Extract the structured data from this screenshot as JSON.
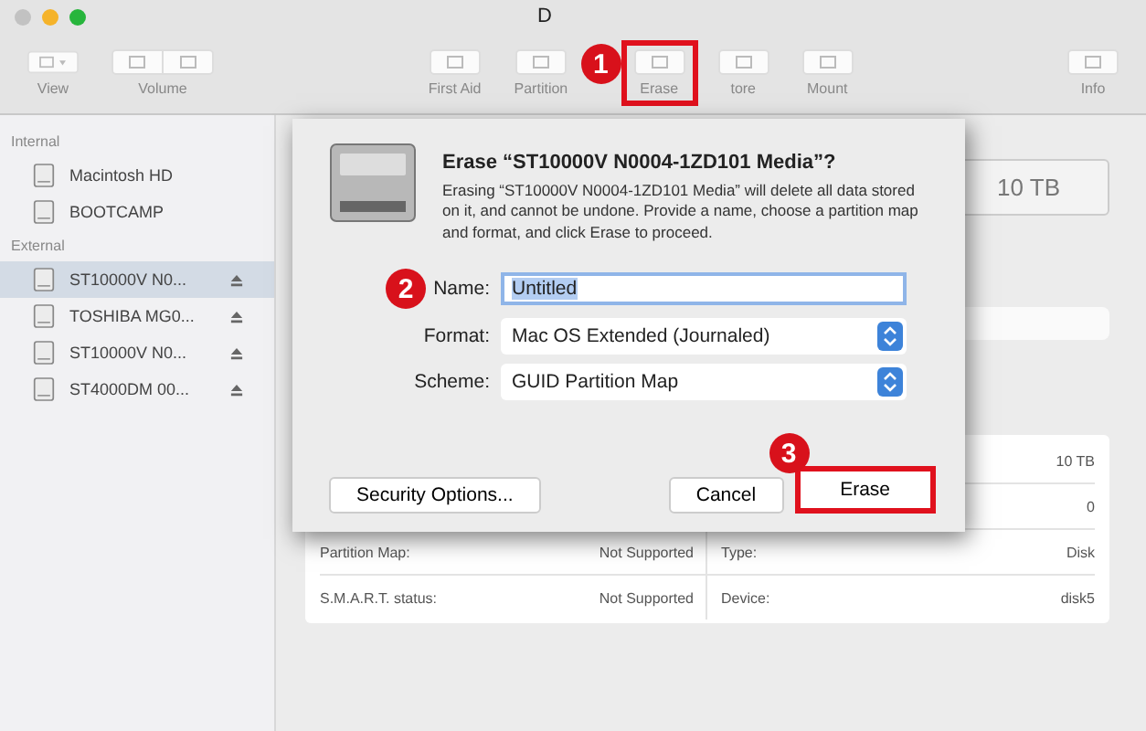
{
  "window": {
    "title": "D"
  },
  "toolbar": [
    {
      "label": "View",
      "kind": "menu",
      "highlighted": false
    },
    {
      "label": "Volume",
      "kind": "pair",
      "highlighted": false
    },
    {
      "label": "First Aid",
      "kind": "single",
      "highlighted": false
    },
    {
      "label": "Partition",
      "kind": "single",
      "highlighted": false
    },
    {
      "label": "Erase",
      "kind": "single",
      "highlighted": true,
      "callout": "1"
    },
    {
      "label": "tore",
      "kind": "single",
      "highlighted": false
    },
    {
      "label": "Mount",
      "kind": "single",
      "highlighted": false
    },
    {
      "label": "Info",
      "kind": "single",
      "highlighted": false
    }
  ],
  "sidebar": {
    "sections": [
      {
        "heading": "Internal",
        "items": [
          {
            "label": "Macintosh HD",
            "selected": false,
            "ejectable": false
          },
          {
            "label": "BOOTCAMP",
            "selected": false,
            "ejectable": false
          }
        ]
      },
      {
        "heading": "External",
        "items": [
          {
            "label": "ST10000V N0...",
            "selected": true,
            "ejectable": true
          },
          {
            "label": "TOSHIBA MG0...",
            "selected": false,
            "ejectable": true
          },
          {
            "label": "ST10000V N0...",
            "selected": false,
            "ejectable": true
          },
          {
            "label": "ST4000DM 00...",
            "selected": false,
            "ejectable": true
          }
        ]
      }
    ]
  },
  "main": {
    "capacity": "10 TB",
    "info_rows": [
      {
        "right_value": "10 TB"
      },
      {
        "right_value": "0"
      },
      {
        "left_label": "Partition Map:",
        "left_value": "Not Supported",
        "right_label": "Type:",
        "right_value": "Disk"
      },
      {
        "left_label": "S.M.A.R.T. status:",
        "left_value": "Not Supported",
        "right_label": "Device:",
        "right_value": "disk5"
      }
    ]
  },
  "dialog": {
    "title": "Erase “ST10000V N0004-1ZD101 Media”?",
    "message": "Erasing “ST10000V N0004-1ZD101 Media” will delete all data stored on it, and cannot be undone. Provide a name, choose a partition map and format, and click Erase to proceed.",
    "fields": [
      {
        "kind": "text",
        "label": "Name:",
        "value": "Untitled",
        "text_selected": true,
        "callout": "2"
      },
      {
        "kind": "popup",
        "label": "Format:",
        "value": "Mac OS Extended (Journaled)"
      },
      {
        "kind": "popup",
        "label": "Scheme:",
        "value": "GUID Partition Map"
      }
    ],
    "buttons": [
      {
        "label": "Security Options...",
        "kind": "secondary",
        "highlighted": false
      },
      {
        "label": "Cancel",
        "kind": "cancel",
        "highlighted": false
      },
      {
        "label": "Erase",
        "kind": "default",
        "highlighted": true,
        "callout": "3"
      }
    ]
  }
}
